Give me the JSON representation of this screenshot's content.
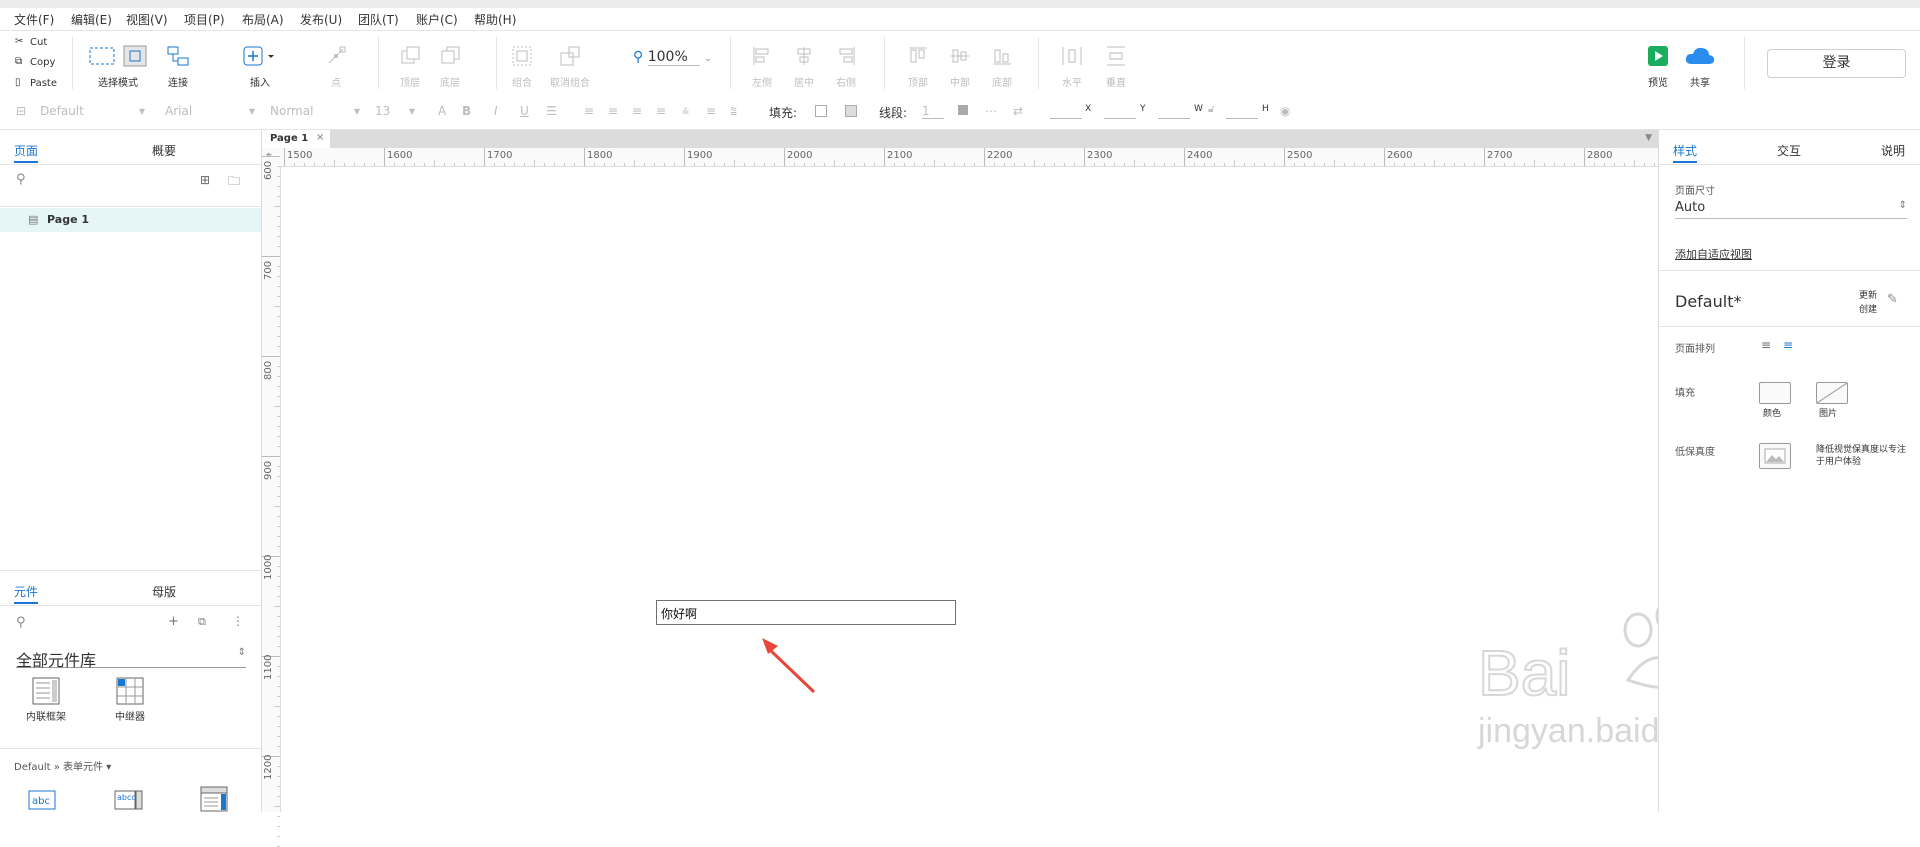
{
  "menu": [
    "文件(F)",
    "编辑(E)",
    "视图(V)",
    "项目(P)",
    "布局(A)",
    "发布(U)",
    "团队(T)",
    "账户(C)",
    "帮助(H)"
  ],
  "clipboard": {
    "cut": "Cut",
    "copy": "Copy",
    "paste": "Paste"
  },
  "toolbar": {
    "select_mode": "选择模式",
    "connect": "连接",
    "insert": "插入",
    "point": "点",
    "top_layer": "顶层",
    "bottom_layer": "底层",
    "group": "组合",
    "ungroup": "取消组合",
    "zoom": "100%",
    "align_left": "左侧",
    "align_center": "居中",
    "align_right": "右侧",
    "align_top": "顶部",
    "align_middle": "中部",
    "align_bottom": "底部",
    "dist_h": "水平",
    "dist_v": "垂直",
    "preview": "预览",
    "share": "共享",
    "login": "登录"
  },
  "format": {
    "style": "Default",
    "font": "Arial",
    "weight": "Normal",
    "size": "13",
    "fill_label": "填充:",
    "line_label": "线段:",
    "line_value": "1",
    "x_label": "X",
    "y_label": "Y",
    "w_label": "W",
    "h_label": "H"
  },
  "left": {
    "tab_pages": "页面",
    "tab_outline": "概要",
    "page_item": "Page 1",
    "tab_widgets": "元件",
    "tab_masters": "母版",
    "library": "全部元件库",
    "widget1": "内联框架",
    "widget2": "中继器",
    "breadcrumb": "Default » 表单元件 ▾"
  },
  "canvas": {
    "page_tab": "Page 1",
    "ruler_h": [
      "1500",
      "1600",
      "1700",
      "1800",
      "1900",
      "2000",
      "2100",
      "2200",
      "2300",
      "2400",
      "2500",
      "2600",
      "2700",
      "2800"
    ],
    "ruler_v": [
      "600",
      "700",
      "800",
      "900",
      "1000",
      "1100",
      "1200"
    ],
    "textbox_value": "你好啊"
  },
  "right": {
    "tab_style": "样式",
    "tab_interact": "交互",
    "tab_notes": "说明",
    "page_size_label": "页面尺寸",
    "page_size_value": "Auto",
    "adaptive_link": "添加自适应视图",
    "style_name": "Default*",
    "update": "更新",
    "create": "创建",
    "page_align_label": "页面排列",
    "fill_label": "填充",
    "fill_color": "颜色",
    "fill_image": "图片",
    "low_fidelity_label": "低保真度",
    "low_fidelity_desc1": "降低视觉保真度以专注",
    "low_fidelity_desc2": "于用户体验"
  },
  "watermark": {
    "logo": "Bai 经验",
    "url": "jingyan.baidu.com"
  },
  "colors": {
    "accent": "#1976d2",
    "preview_green": "#1aae5c",
    "share_blue": "#2b8cf0",
    "arrow_red": "#e8463a"
  }
}
